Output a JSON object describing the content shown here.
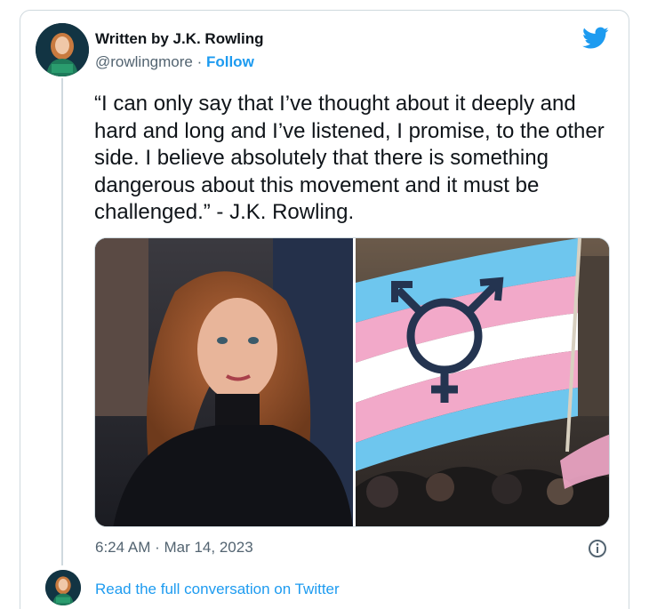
{
  "tweet": {
    "author_name": "Written by J.K. Rowling",
    "handle": "@rowlingmore",
    "separator": " · ",
    "follow_label": "Follow",
    "text": "“I can only say that I’ve thought about it deeply and hard and long and I’ve listened, I promise, to the other side. I believe absolutely that there is something dangerous about this movement and it must be challenged.” - J.K. Rowling.",
    "timestamp": "6:24 AM · Mar 14, 2023",
    "read_more_label": "Read the full conversation on Twitter"
  },
  "media": {
    "left_image": "portrait-photo",
    "right_image": "transgender-pride-flag-photo"
  },
  "icons": {
    "logo": "twitter-bird-icon",
    "info": "info-icon"
  },
  "colors": {
    "accent": "#1d9bf0",
    "text_primary": "#0f1419",
    "text_secondary": "#536471",
    "border": "#cfd9de",
    "flag_blue": "#6ec6ee",
    "flag_pink": "#f2a9c9",
    "flag_white": "#ffffff"
  }
}
